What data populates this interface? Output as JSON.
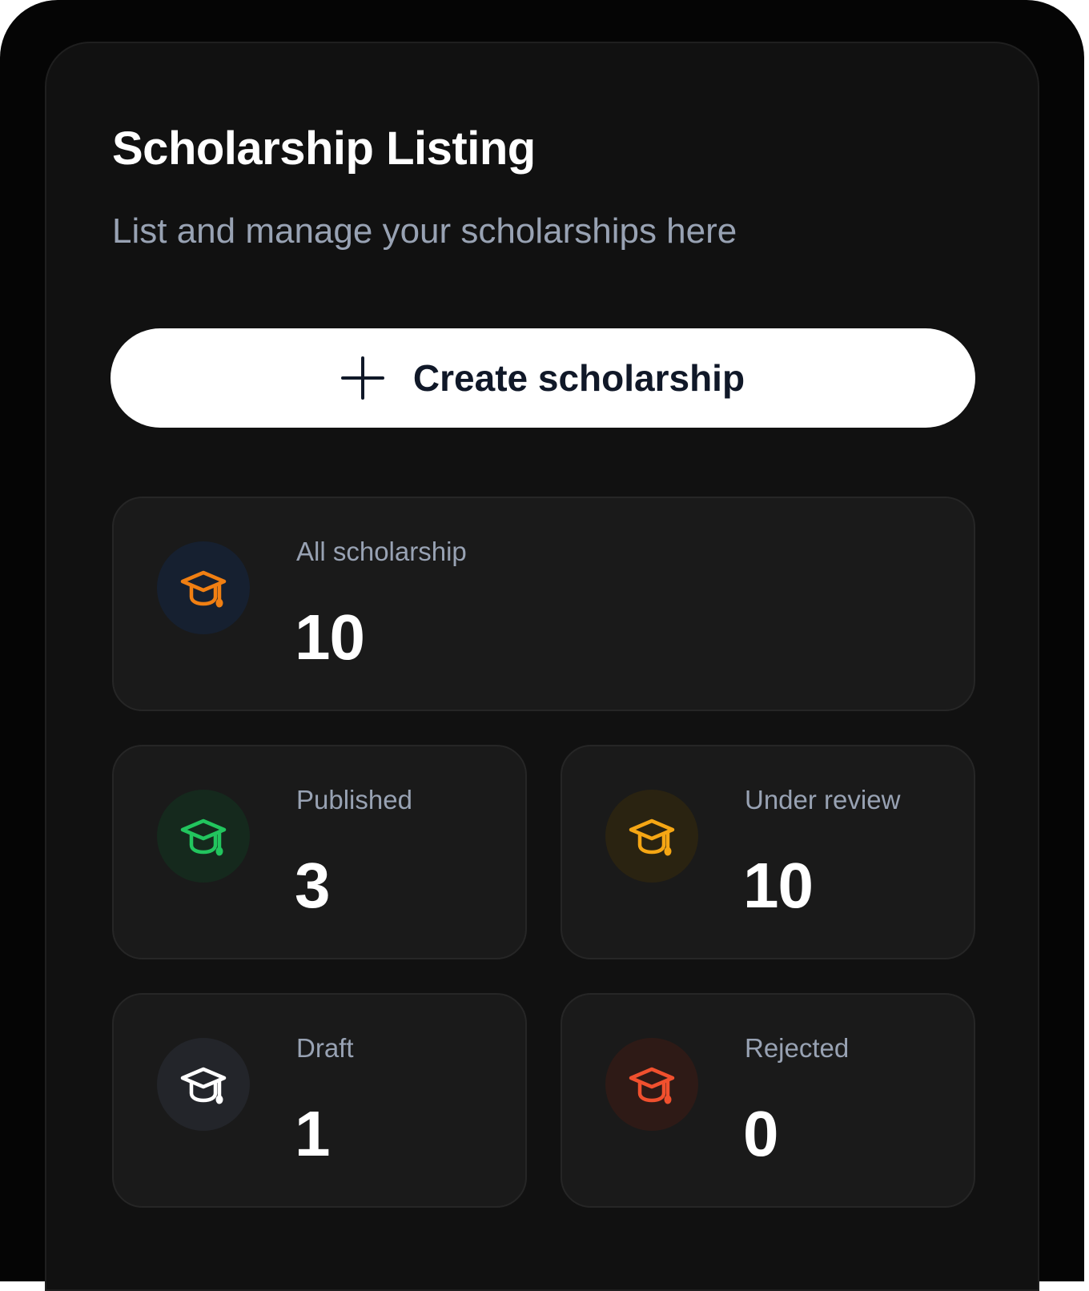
{
  "header": {
    "title": "Scholarship Listing",
    "subtitle": "List and manage your scholarships here"
  },
  "create_button": {
    "label": "Create scholarship",
    "icon": "plus-icon"
  },
  "stats": {
    "all": {
      "label": "All scholarship",
      "value": "10",
      "icon": "graduation-cap-icon",
      "color": "#f07f12",
      "bg": "#162030"
    },
    "published": {
      "label": "Published",
      "value": "3",
      "icon": "graduation-cap-icon",
      "color": "#22c55e",
      "bg": "#15291d"
    },
    "under_review": {
      "label": "Under review",
      "value": "10",
      "icon": "graduation-cap-icon",
      "color": "#f5a614",
      "bg": "#2a2311"
    },
    "draft": {
      "label": "Draft",
      "value": "1",
      "icon": "graduation-cap-icon",
      "color": "#ffffff",
      "bg": "#23252a"
    },
    "rejected": {
      "label": "Rejected",
      "value": "0",
      "icon": "graduation-cap-icon",
      "color": "#f0502e",
      "bg": "#2e1a16"
    }
  }
}
